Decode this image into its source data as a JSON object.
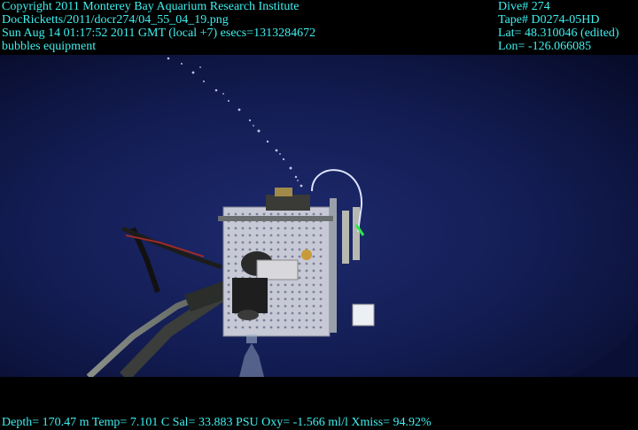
{
  "header_left": [
    "Copyright 2011 Monterey Bay Aquarium Research Institute",
    "DocRicketts/2011/docr274/04_55_04_19.png",
    "Sun Aug 14 01:17:52 2011 GMT (local +7)  esecs=1313284672",
    "bubbles equipment"
  ],
  "header_right": [
    "Dive# 274",
    "Tape# D0274-05HD",
    "Lat= 48.310046 (edited)",
    "Lon= -126.066085"
  ],
  "footer": "Depth= 170.47 m  Temp= 7.101 C  Sal= 33.883 PSU  Oxy= -1.566 ml/l  Xmiss= 94.92%",
  "colors": {
    "overlay_text": "#3ff0f0",
    "water_dark": "#070d2e",
    "water_mid": "#1a2468"
  }
}
